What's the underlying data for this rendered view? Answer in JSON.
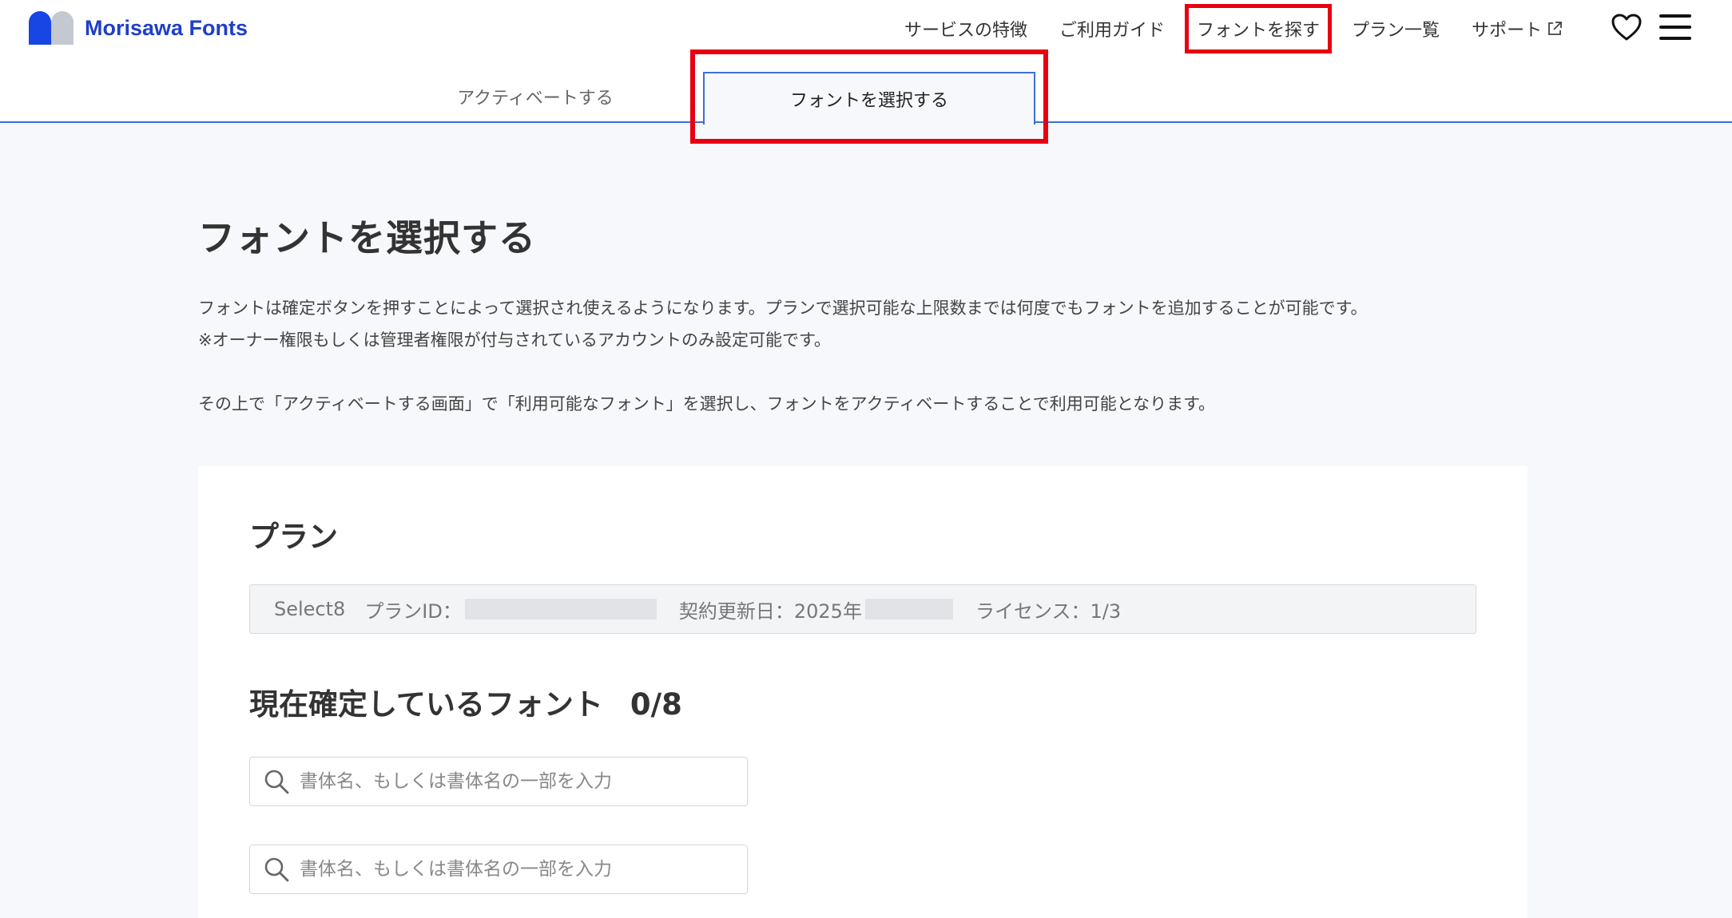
{
  "header": {
    "logo_text": "Morisawa Fonts",
    "nav": {
      "features": "サービスの特徴",
      "guide": "ご利用ガイド",
      "find_fonts": "フォントを探す",
      "plans": "プラン一覧",
      "support": "サポート"
    },
    "icons": [
      "external-link-icon",
      "heart-icon",
      "hamburger-menu-icon"
    ]
  },
  "tabs": {
    "activate": "アクティベートする",
    "select": "フォントを選択する"
  },
  "main": {
    "title": "フォントを選択する",
    "desc_line1": "フォントは確定ボタンを押すことによって選択され使えるようになります。プランで選択可能な上限数までは何度でもフォントを追加することが可能です。",
    "desc_line2": "※オーナー権限もしくは管理者権限が付与されているアカウントのみ設定可能です。",
    "desc_line3": "その上で「アクティベートする画面」で「利用可能なフォント」を選択し、フォントをアクティベートすることで利用可能となります。"
  },
  "plan": {
    "heading": "プラン",
    "name": "Select8",
    "id_label": "プランID：",
    "renewal_label": "契約更新日：2025年",
    "license": "ライセンス：1/3"
  },
  "fonts": {
    "heading": "現在確定しているフォント",
    "count": "0/8",
    "search_placeholder": "書体名、もしくは書体名の一部を入力"
  },
  "colors": {
    "brand": "#1f3fc7",
    "tab_border": "#3b6fd6",
    "highlight": "#e60012"
  }
}
